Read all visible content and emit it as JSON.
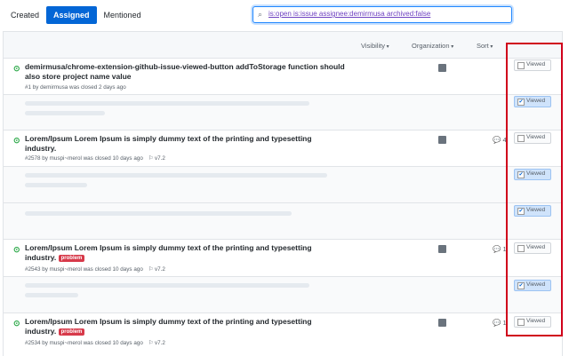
{
  "tabs": [
    "Created",
    "Assigned",
    "Mentioned"
  ],
  "search": {
    "query": "is:open is:issue assignee:demirmusa archived:false"
  },
  "filters": {
    "visibility": "Visibility",
    "organization": "Organization",
    "sort": "Sort"
  },
  "issues": [
    {
      "title": "demirmusa/chrome-extension-github-issue-viewed-button  addToStorage function should also store project name value",
      "meta": "#1 by demirmusa was closed 2 days ago",
      "label": "",
      "milestone": "",
      "comments": "",
      "viewed": false
    },
    {
      "title": "Lorem/Ipsum  Lorem Ipsum is simply dummy text of the printing and typesetting industry.",
      "meta": "#2578 by muspi~merol was closed 10 days ago",
      "label": "",
      "milestone": "v7.2",
      "comments": "4",
      "viewed": false
    },
    {
      "title": "Lorem/Ipsum  Lorem Ipsum is simply dummy text of the printing and typesetting industry.",
      "meta": "#2543 by muspi~merol was closed 10 days ago",
      "label": "problem",
      "milestone": "v7.2",
      "comments": "1",
      "viewed": false
    },
    {
      "title": "Lorem/Ipsum  Lorem Ipsum is simply dummy text of the printing and typesetting industry.",
      "meta": "#2534 by muspi~merol was closed 10 days ago",
      "label": "problem",
      "milestone": "v7.2",
      "comments": "1",
      "viewed": false
    }
  ],
  "viewed_label": "Viewed",
  "viewed_states": [
    false,
    true,
    false,
    true,
    true,
    false,
    true,
    false
  ],
  "colors": {
    "accent": "#0366d6",
    "open": "#28a745",
    "problem": "#d73a4a",
    "highlight": "#d0021b"
  }
}
